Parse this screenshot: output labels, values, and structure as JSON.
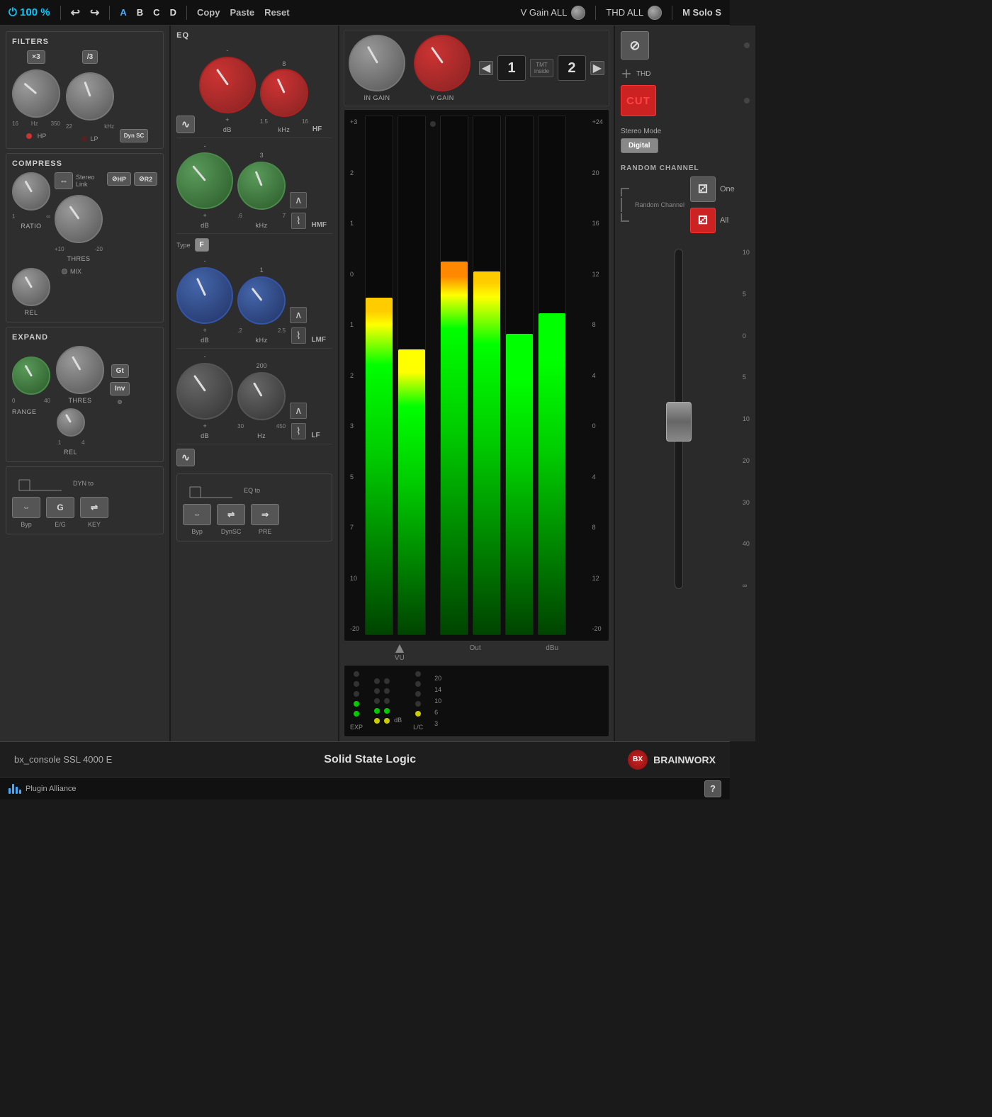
{
  "toolbar": {
    "power": "⏻ 100 %",
    "undo": "↩",
    "redo": "↪",
    "a": "A",
    "b": "B",
    "c": "C",
    "d": "D",
    "copy": "Copy",
    "paste": "Paste",
    "reset": "Reset",
    "vgain_all": "V Gain ALL",
    "thd_all": "THD ALL",
    "m_solo_s": "M Solo S"
  },
  "filters": {
    "label": "FILTERS",
    "x3_btn": "×3",
    "div3_btn": "/3",
    "hp_label": "HP",
    "lp_label": "LP",
    "dyn_sc": "Dyn SC",
    "hz_16": "16",
    "hz_350": "350",
    "khz_22": "22",
    "khz_label": "kHz"
  },
  "compress": {
    "label": "COMPRESS",
    "ratio_label": "RATIO",
    "thres_label": "THRES",
    "rel_label": "REL",
    "mix_label": "MIX",
    "stereo_link": "Stereo Link",
    "ratio_min": "1",
    "ratio_max": "∞",
    "thres_min": "-20",
    "thres_max": "+10",
    "hp_btn": "HP",
    "r2_btn": "R2"
  },
  "expand": {
    "label": "EXPAND",
    "thres_label": "THRES",
    "range_label": "RANGE",
    "rel_label": "REL",
    "gt_btn": "Gt",
    "inv_btn": "Inv",
    "range_min": "0",
    "range_max": "40",
    "rel_min": ".1",
    "rel_max": "4"
  },
  "dyn_routing": {
    "dyn_to": "DYN to",
    "byp": "Byp",
    "eg": "E/G",
    "key": "KEY"
  },
  "eq": {
    "label": "EQ",
    "hf_label": "HF",
    "hmf_label": "HMF",
    "lmf_label": "LMF",
    "lf_label": "LF",
    "db_label": "dB",
    "khz_label": "kHz",
    "hz_label": "Hz",
    "hf_val": "8",
    "hf_min": "1.5",
    "hf_max": "16",
    "hmf_val": "3",
    "hmf_min": ".6",
    "hmf_max": "7",
    "lmf_val": "1",
    "lmf_min": ".2",
    "lmf_max": "2.5",
    "lf_val": "200",
    "lf_min": "30",
    "lf_max": "450",
    "type_label": "Type",
    "type_f": "F",
    "eq_to": "EQ to",
    "byp": "Byp",
    "dynsc": "DynSC",
    "pre": "PRE"
  },
  "channel": {
    "in_gain": "IN GAIN",
    "v_gain": "V GAIN",
    "thd": "THD",
    "cut": "CUT",
    "left_ch": "1",
    "right_ch": "2",
    "tmt_label": "TMT",
    "inside_label": "inside",
    "stereo_mode": "Stereo Mode",
    "digital_btn": "Digital",
    "phase_btn": "⊘",
    "random_channel": "RANDOM CHANNEL",
    "random_label": "Random Channel",
    "one_label": "One",
    "all_label": "All"
  },
  "vu_meter": {
    "vu_label": "VU",
    "out_label": "Out",
    "dbu_label": "dBu",
    "scale_top": "+3",
    "scale_db24": "+24",
    "scale_db20": "20",
    "scale_db16": "16",
    "scale_db12": "12",
    "scale_db8": "8",
    "scale_db4": "4",
    "scale_0": "0",
    "scale_4": "4",
    "scale_8": "8",
    "scale_12": "12",
    "scale_16": "16",
    "scale_20": "-20"
  },
  "led_matrix": {
    "exp_label": "EXP",
    "db_label": "dB",
    "lc_label": "L/C",
    "levels": [
      "20",
      "14",
      "10",
      "6",
      "3"
    ]
  },
  "fader": {
    "scale": [
      "10",
      "5",
      "0",
      "5",
      "10",
      "20",
      "30",
      "40",
      "∞"
    ]
  },
  "bottom_bar": {
    "plugin_name": "bx_console SSL 4000 E",
    "brand_name": "Solid State Logic",
    "brainworx": "BRAINWORX"
  },
  "footer": {
    "plugin_alliance": "Plugin Alliance",
    "help": "?"
  }
}
